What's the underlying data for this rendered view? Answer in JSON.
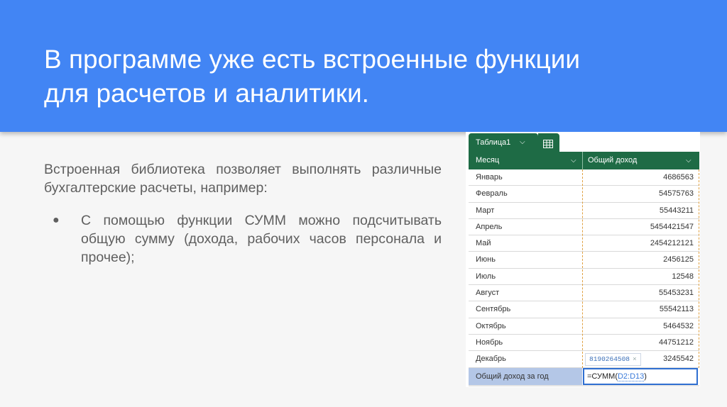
{
  "slide": {
    "title_line1": "В программе уже есть встроенные функции",
    "title_line2": "для расчетов и аналитики.",
    "paragraph": "Встроенная библиотека позволяет выполнять различные бухгалтерские расчеты, например:",
    "bullet_symbol": "●",
    "bullet": "С помощью функции СУММ можно подсчитывать общую сумму (дохода, рабочих часов персонала и прочее);"
  },
  "sheet": {
    "tab_label": "Таблица1",
    "tab_chevron": "⌵",
    "col_a_header": "Месяц",
    "col_b_header": "Общий доход",
    "header_chevron": "⌵",
    "rows": [
      {
        "month": "Январь",
        "income": "4686563"
      },
      {
        "month": "Февраль",
        "income": "54575763"
      },
      {
        "month": "Март",
        "income": "55443211"
      },
      {
        "month": "Апрель",
        "income": "5454421547"
      },
      {
        "month": "Май",
        "income": "2454212121"
      },
      {
        "month": "Июнь",
        "income": "2456125"
      },
      {
        "month": "Июль",
        "income": "12548"
      },
      {
        "month": "Август",
        "income": "55453231"
      },
      {
        "month": "Сентябрь",
        "income": "55542113"
      },
      {
        "month": "Октябрь",
        "income": "5464532"
      },
      {
        "month": "Ноябрь",
        "income": "44751212"
      },
      {
        "month": "Декабрь",
        "income": "3245542"
      }
    ],
    "tooltip_value": "8190264508",
    "tooltip_close": "×",
    "total_label": "Общий доход за год",
    "formula_prefix": "=СУММ(",
    "formula_ref": "D2:D13",
    "formula_suffix": ")",
    "accent_green": "#1e6b45",
    "accent_blue": "#2f6fd1"
  },
  "colors": {
    "header_bg": "#4285f4",
    "body_bg": "#f6f6f6",
    "text_gray": "#5f5f5f"
  }
}
